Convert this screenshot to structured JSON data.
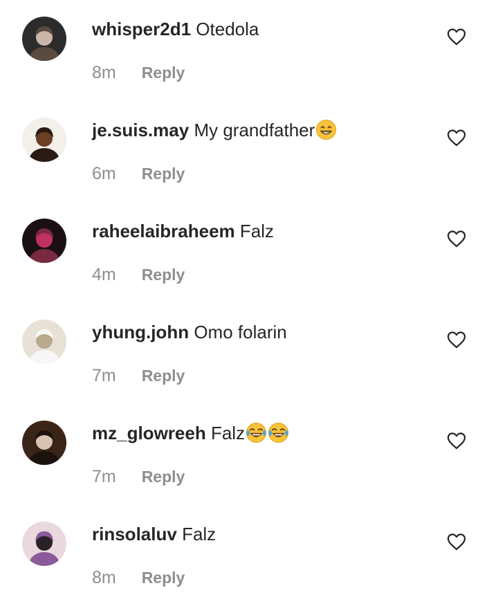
{
  "comments": [
    {
      "username": "whisper2d1",
      "text": "Otedola",
      "emoji": [],
      "time": "8m",
      "reply_label": "Reply",
      "avatar_colors": [
        "#2b2b2b",
        "#c9b6a8",
        "#5a4a40"
      ]
    },
    {
      "username": "je.suis.may",
      "text": "My grandfather",
      "emoji": [
        "grinning-face-icon"
      ],
      "time": "6m",
      "reply_label": "Reply",
      "avatar_colors": [
        "#f3efe9",
        "#6b3e25",
        "#2a1a14"
      ]
    },
    {
      "username": "raheelaibraheem",
      "text": "Falz",
      "emoji": [],
      "time": "4m",
      "reply_label": "Reply",
      "avatar_colors": [
        "#1a1014",
        "#c03060",
        "#7a2a40"
      ]
    },
    {
      "username": "yhung.john",
      "text": "Omo folarin",
      "emoji": [],
      "time": "7m",
      "reply_label": "Reply",
      "avatar_colors": [
        "#e8e2d6",
        "#b8a98f",
        "#f7f7f7"
      ]
    },
    {
      "username": "mz_glowreeh",
      "text": "Falz",
      "emoji": [
        "tears-of-joy-icon",
        "tears-of-joy-icon"
      ],
      "time": "7m",
      "reply_label": "Reply",
      "avatar_colors": [
        "#3a2418",
        "#d7c3b2",
        "#1c120d"
      ]
    },
    {
      "username": "rinsolaluv",
      "text": "Falz",
      "emoji": [],
      "time": "8m",
      "reply_label": "Reply",
      "avatar_colors": [
        "#ead8df",
        "#2b2228",
        "#8a5a9a"
      ]
    }
  ],
  "icons": {
    "like": "heart-outline-icon"
  },
  "colors": {
    "username": "#262626",
    "meta": "#8e8e8e",
    "heart_stroke": "#262626"
  }
}
